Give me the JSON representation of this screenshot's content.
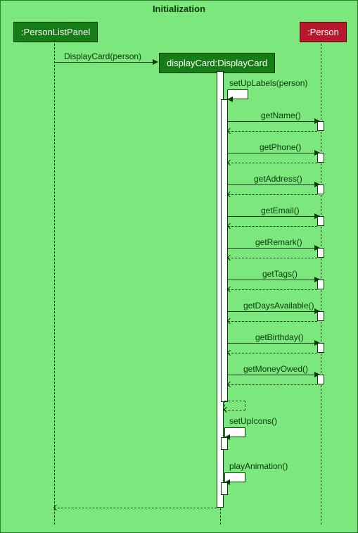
{
  "frame": {
    "title": "Initialization"
  },
  "participants": {
    "personListPanel": ":PersonListPanel",
    "displayCard": "displayCard:DisplayCard",
    "person": ":Person"
  },
  "messages": {
    "create": "DisplayCard(person)",
    "setUpLabels": "setUpLabels(person)",
    "getName": "getName()",
    "getPhone": "getPhone()",
    "getAddress": "getAddress()",
    "getEmail": "getEmail()",
    "getRemark": "getRemark()",
    "getTags": "getTags()",
    "getDaysAvailable": "getDaysAvailable()",
    "getBirthday": "getBirthday()",
    "getMoneyOwed": "getMoneyOwed()",
    "setUpIcons": "setUpIcons()",
    "playAnimation": "playAnimation()"
  },
  "chart_data": {
    "type": "sequence-diagram",
    "frame": "Initialization",
    "participants": [
      {
        "name": ":PersonListPanel",
        "color": "green"
      },
      {
        "name": "displayCard:DisplayCard",
        "color": "green",
        "created_by_first_message": true
      },
      {
        "name": ":Person",
        "color": "red"
      }
    ],
    "interactions": [
      {
        "from": ":PersonListPanel",
        "to": "displayCard:DisplayCard",
        "label": "DisplayCard(person)",
        "type": "create"
      },
      {
        "from": "displayCard:DisplayCard",
        "to": "displayCard:DisplayCard",
        "label": "setUpLabels(person)",
        "type": "self"
      },
      {
        "from": "displayCard:DisplayCard",
        "to": ":Person",
        "label": "getName()",
        "type": "call-return"
      },
      {
        "from": "displayCard:DisplayCard",
        "to": ":Person",
        "label": "getPhone()",
        "type": "call-return"
      },
      {
        "from": "displayCard:DisplayCard",
        "to": ":Person",
        "label": "getAddress()",
        "type": "call-return"
      },
      {
        "from": "displayCard:DisplayCard",
        "to": ":Person",
        "label": "getEmail()",
        "type": "call-return"
      },
      {
        "from": "displayCard:DisplayCard",
        "to": ":Person",
        "label": "getRemark()",
        "type": "call-return"
      },
      {
        "from": "displayCard:DisplayCard",
        "to": ":Person",
        "label": "getTags()",
        "type": "call-return"
      },
      {
        "from": "displayCard:DisplayCard",
        "to": ":Person",
        "label": "getDaysAvailable()",
        "type": "call-return"
      },
      {
        "from": "displayCard:DisplayCard",
        "to": ":Person",
        "label": "getBirthday()",
        "type": "call-return"
      },
      {
        "from": "displayCard:DisplayCard",
        "to": ":Person",
        "label": "getMoneyOwed()",
        "type": "call-return"
      },
      {
        "from": "displayCard:DisplayCard",
        "to": "displayCard:DisplayCard",
        "label": "",
        "type": "self-return-dashed"
      },
      {
        "from": "displayCard:DisplayCard",
        "to": "displayCard:DisplayCard",
        "label": "setUpIcons()",
        "type": "self"
      },
      {
        "from": "displayCard:DisplayCard",
        "to": "displayCard:DisplayCard",
        "label": "playAnimation()",
        "type": "self"
      },
      {
        "from": "displayCard:DisplayCard",
        "to": ":PersonListPanel",
        "label": "",
        "type": "return"
      }
    ]
  }
}
